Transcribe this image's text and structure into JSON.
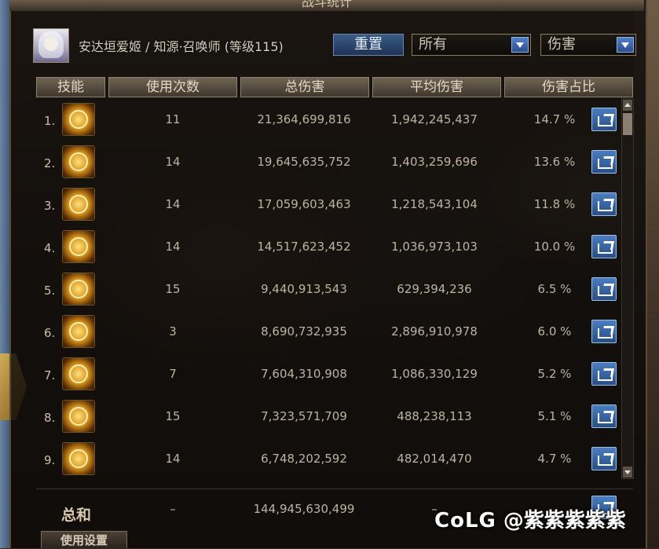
{
  "window": {
    "title": "战斗统计"
  },
  "player": {
    "name": "安达垣爱姬 / 知源·召唤师 (等级115)"
  },
  "controls": {
    "reset_label": "重置",
    "filter_selected": "所有",
    "metric_selected": "伤害"
  },
  "table": {
    "headers": [
      "技能",
      "使用次数",
      "总伤害",
      "平均伤害",
      "伤害占比"
    ],
    "rows": [
      {
        "rank": "1.",
        "uses": "11",
        "total": "21,364,699,816",
        "avg": "1,942,245,437",
        "pct": "14.7 %"
      },
      {
        "rank": "2.",
        "uses": "14",
        "total": "19,645,635,752",
        "avg": "1,403,259,696",
        "pct": "13.6 %"
      },
      {
        "rank": "3.",
        "uses": "14",
        "total": "17,059,603,463",
        "avg": "1,218,543,104",
        "pct": "11.8 %"
      },
      {
        "rank": "4.",
        "uses": "14",
        "total": "14,517,623,452",
        "avg": "1,036,973,103",
        "pct": "10.0 %"
      },
      {
        "rank": "5.",
        "uses": "15",
        "total": "9,440,913,543",
        "avg": "629,394,236",
        "pct": "6.5 %"
      },
      {
        "rank": "6.",
        "uses": "3",
        "total": "8,690,732,935",
        "avg": "2,896,910,978",
        "pct": "6.0 %"
      },
      {
        "rank": "7.",
        "uses": "7",
        "total": "7,604,310,908",
        "avg": "1,086,330,129",
        "pct": "5.2 %"
      },
      {
        "rank": "8.",
        "uses": "15",
        "total": "7,323,571,709",
        "avg": "488,238,113",
        "pct": "5.1 %"
      },
      {
        "rank": "9.",
        "uses": "14",
        "total": "6,748,202,592",
        "avg": "482,014,470",
        "pct": "4.7 %"
      }
    ]
  },
  "total": {
    "label": "总和",
    "uses": "–",
    "damage": "144,945,630,499",
    "avg": "–"
  },
  "footer": {
    "usage_tab": "使用设置"
  },
  "watermark": {
    "brand": "CoLG",
    "handle": "@紫紫紫紫紫"
  },
  "colors": {
    "accent_blue": "#3a6aa8",
    "gold": "#d6931c",
    "text": "#bdb3a2"
  }
}
